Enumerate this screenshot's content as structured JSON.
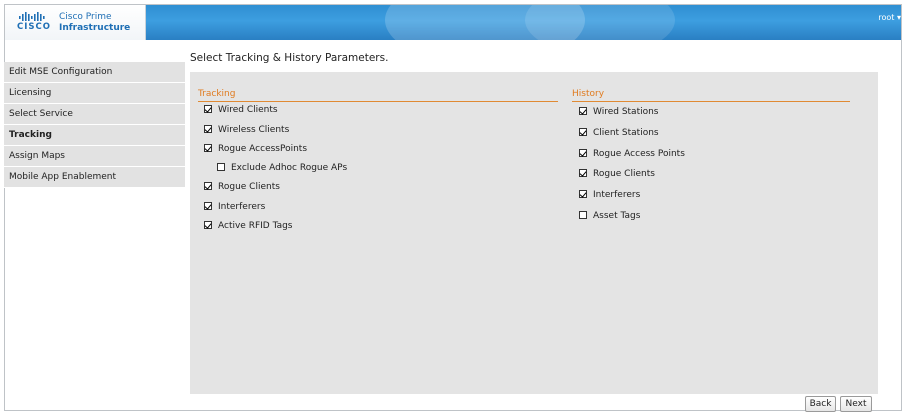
{
  "header": {
    "brand": "CISCO",
    "product_line1": "Cisco Prime",
    "product_line2": "Infrastructure",
    "user": "root"
  },
  "page_title": "Select Tracking & History Parameters.",
  "sidebar": {
    "items": [
      {
        "label": "Edit MSE Configuration",
        "active": false
      },
      {
        "label": "Licensing",
        "active": false
      },
      {
        "label": "Select Service",
        "active": false
      },
      {
        "label": "Tracking",
        "active": true
      },
      {
        "label": "Assign Maps",
        "active": false
      },
      {
        "label": "Mobile App Enablement",
        "active": false
      }
    ]
  },
  "tracking": {
    "title": "Tracking",
    "options": [
      {
        "label": "Wired Clients",
        "checked": true
      },
      {
        "label": "Wireless Clients",
        "checked": true
      },
      {
        "label": "Rogue AccessPoints",
        "checked": true
      },
      {
        "label": "Exclude Adhoc Rogue APs",
        "checked": false
      },
      {
        "label": "Rogue Clients",
        "checked": true
      },
      {
        "label": "Interferers",
        "checked": true
      },
      {
        "label": "Active RFID Tags",
        "checked": true
      }
    ]
  },
  "history": {
    "title": "History",
    "options": [
      {
        "label": "Wired Stations",
        "checked": true
      },
      {
        "label": "Client Stations",
        "checked": true
      },
      {
        "label": "Rogue Access Points",
        "checked": true
      },
      {
        "label": "Rogue Clients",
        "checked": true
      },
      {
        "label": "Interferers",
        "checked": true
      },
      {
        "label": "Asset Tags",
        "checked": false
      }
    ]
  },
  "buttons": {
    "back": "Back",
    "next": "Next"
  },
  "colors": {
    "header_blue": "#2f8fd2",
    "section_orange": "#e07b1f",
    "panel_gray": "#e4e4e4"
  }
}
